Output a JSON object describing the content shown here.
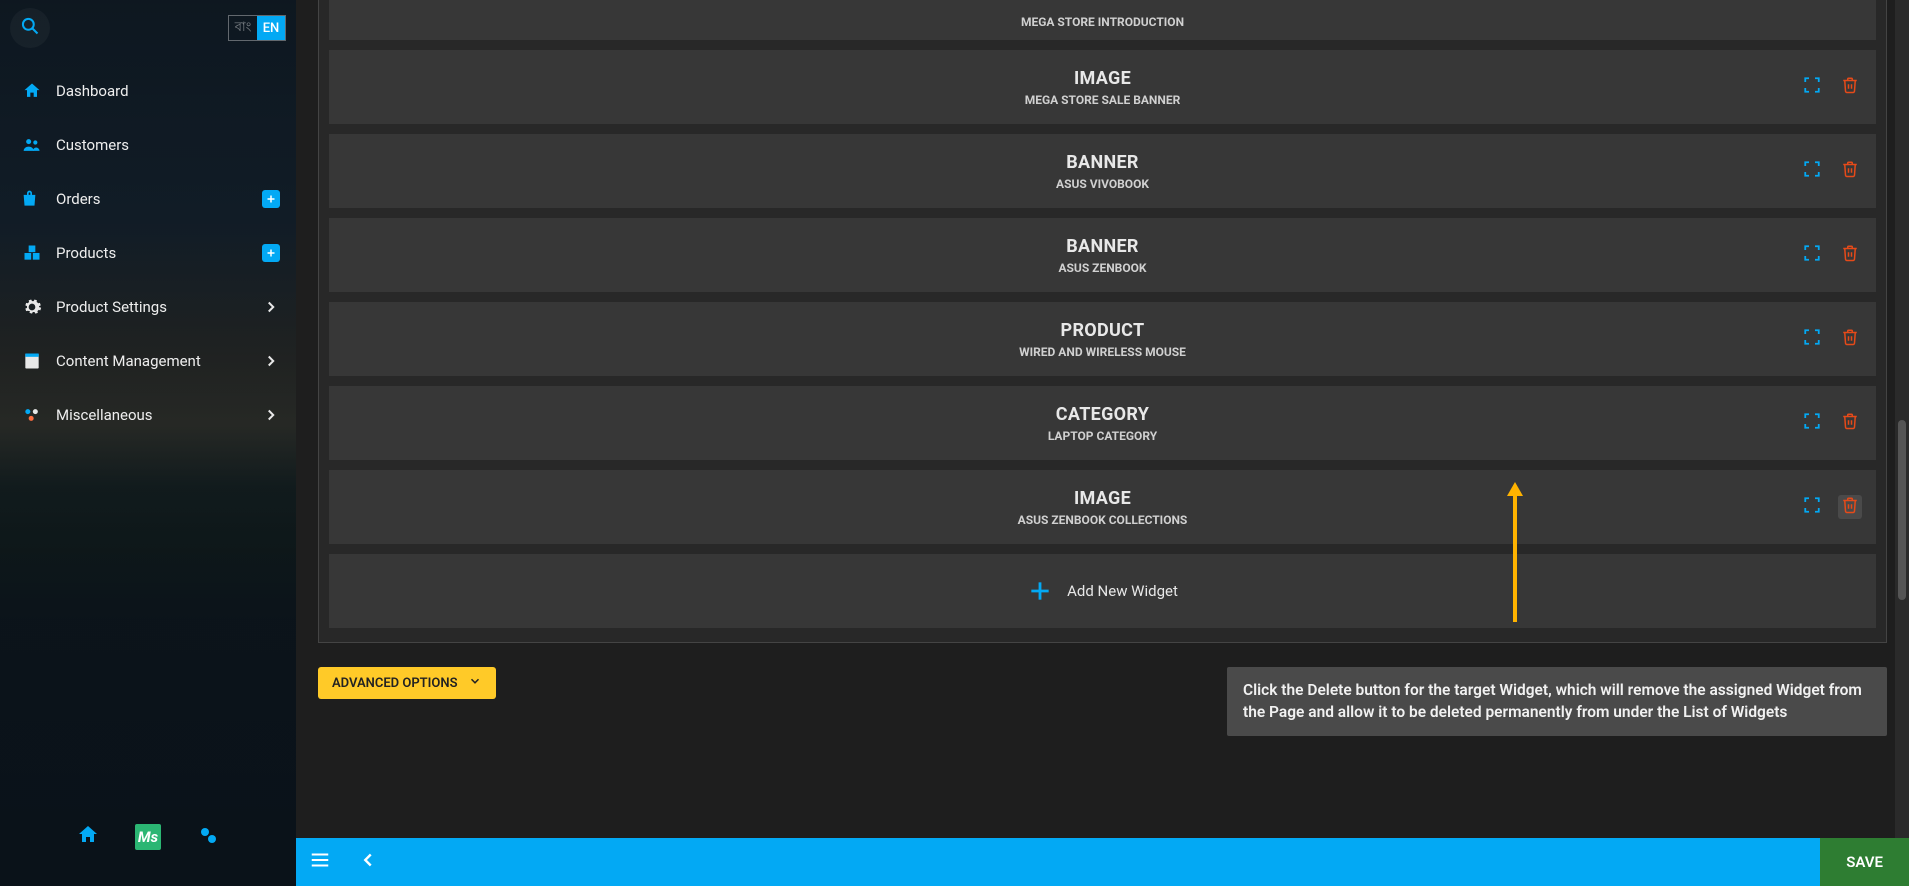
{
  "language": {
    "inactive": "বাং",
    "active": "EN"
  },
  "sidebar": {
    "items": [
      {
        "label": "Dashboard",
        "icon": "home",
        "tail": "none"
      },
      {
        "label": "Customers",
        "icon": "group",
        "tail": "none"
      },
      {
        "label": "Orders",
        "icon": "cart",
        "tail": "plus"
      },
      {
        "label": "Products",
        "icon": "boxes",
        "tail": "plus"
      },
      {
        "label": "Product Settings",
        "icon": "gear",
        "tail": "chev"
      },
      {
        "label": "Content Management",
        "icon": "page",
        "tail": "chev"
      },
      {
        "label": "Miscellaneous",
        "icon": "dots",
        "tail": "chev"
      }
    ]
  },
  "widgets": [
    {
      "title": "",
      "sub": "MEGA STORE INTRODUCTION",
      "first": true,
      "actions": false
    },
    {
      "title": "IMAGE",
      "sub": "MEGA STORE SALE BANNER",
      "first": false,
      "actions": true
    },
    {
      "title": "BANNER",
      "sub": "ASUS VIVOBOOK",
      "first": false,
      "actions": true
    },
    {
      "title": "BANNER",
      "sub": "ASUS ZENBOOK",
      "first": false,
      "actions": true
    },
    {
      "title": "PRODUCT",
      "sub": "WIRED AND WIRELESS MOUSE",
      "first": false,
      "actions": true
    },
    {
      "title": "CATEGORY",
      "sub": "LAPTOP CATEGORY",
      "first": false,
      "actions": true
    },
    {
      "title": "IMAGE",
      "sub": "ASUS ZENBOOK COLLECTIONS",
      "first": false,
      "actions": true,
      "highlightDelete": true
    }
  ],
  "add_widget_label": "Add New Widget",
  "advanced_options_label": "ADVANCED OPTIONS",
  "tooltip_text": "Click the Delete button for the target Widget, which will remove the assigned Widget from the Page and allow it to be deleted permanently from under the List of Widgets",
  "save_label": "SAVE",
  "colors": {
    "accent": "#03a9f4",
    "danger": "#ff5722",
    "save": "#2e7d32",
    "warn": "#ffca28"
  }
}
